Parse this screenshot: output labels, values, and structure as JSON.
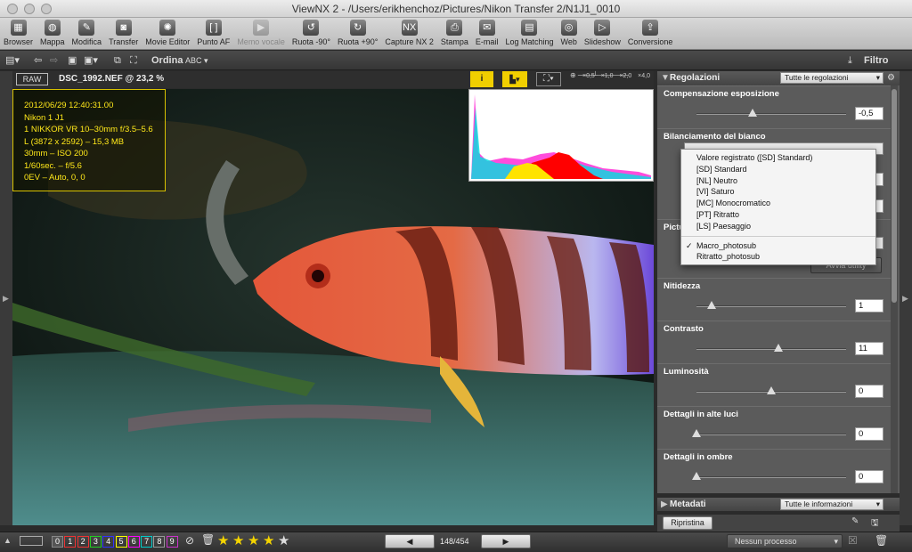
{
  "window": {
    "title": "ViewNX 2 - /Users/erikhenchoz/Pictures/Nikon Transfer 2/N1J1_0010"
  },
  "colors": {
    "accent": "#d8c100",
    "info_text": "#ffe81a"
  },
  "toolbar": {
    "items": [
      {
        "label": "Browser",
        "icon": "browser-icon",
        "enabled": true
      },
      {
        "label": "Mappa",
        "icon": "globe-icon",
        "enabled": true
      },
      {
        "label": "Modifica",
        "icon": "edit-icon",
        "enabled": true
      },
      {
        "label": "Transfer",
        "icon": "camera-icon",
        "enabled": true
      },
      {
        "label": "Movie Editor",
        "icon": "film-reel-icon",
        "enabled": true
      },
      {
        "label": "Punto AF",
        "icon": "af-point-icon",
        "enabled": true
      },
      {
        "label": "Memo vocale",
        "icon": "play-icon",
        "enabled": false
      },
      {
        "label": "Ruota -90°",
        "icon": "rotate-left-icon",
        "enabled": true
      },
      {
        "label": "Ruota +90°",
        "icon": "rotate-right-icon",
        "enabled": true
      },
      {
        "label": "Capture NX 2",
        "icon": "capture-nx-icon",
        "enabled": true
      },
      {
        "label": "Stampa",
        "icon": "print-icon",
        "enabled": true
      },
      {
        "label": "E-mail",
        "icon": "mail-icon",
        "enabled": true
      },
      {
        "label": "Log Matching",
        "icon": "log-icon",
        "enabled": true
      },
      {
        "label": "Web",
        "icon": "web-icon",
        "enabled": true
      },
      {
        "label": "Slideshow",
        "icon": "slideshow-icon",
        "enabled": true
      },
      {
        "label": "Conversione",
        "icon": "convert-icon",
        "enabled": true
      }
    ]
  },
  "subbar": {
    "sort_label": "Ordina",
    "sort_value": "ABC",
    "filter_label": "Filtro"
  },
  "viewer": {
    "raw_badge": "RAW",
    "filename": "DSC_1992.NEF @ 23,2 %",
    "zoom_levels": [
      "×0,5",
      "×1,0",
      "×2,0",
      "×4,0"
    ]
  },
  "info": {
    "lines": [
      "2012/06/29 12:40:31.00",
      "Nikon 1 J1",
      "1 NIKKOR VR 10–30mm f/3.5–5.6",
      "L (3872 x 2592) – 15,3 MB",
      "30mm – ISO 200",
      "1/60sec. – f/5.6",
      "0EV – Auto, 0, 0"
    ]
  },
  "panel": {
    "title": "Regolazioni",
    "filter_select": "Tutte le regolazioni",
    "sections": [
      {
        "label": "Compensazione esposizione",
        "value": "-0,5",
        "level": 0.375
      },
      {
        "label": "Bilanciamento del bianco"
      },
      {
        "label": "Pictu"
      },
      {
        "label": "Nitidezza",
        "value": "1",
        "level": 0.1
      },
      {
        "label": "Contrasto",
        "value": "11",
        "level": 0.55
      },
      {
        "label": "Luminosità",
        "value": "0",
        "level": 0.5
      },
      {
        "label": "Dettagli in alte luci",
        "value": "0",
        "level": 0
      },
      {
        "label": "Dettagli in ombre",
        "value": "0",
        "level": 0
      }
    ],
    "apply_button": "Avvia utility"
  },
  "dropdown": {
    "items": [
      "Valore registrato ([SD] Standard)",
      "[SD] Standard",
      "[NL] Neutro",
      "[VI] Saturo",
      "[MC] Monocromatico",
      "[PT] Ritratto",
      "[LS] Paesaggio"
    ],
    "custom_items": [
      "Macro_photosub",
      "Ritratto_photosub"
    ],
    "checked": "Macro_photosub"
  },
  "metadata": {
    "title": "Metadati",
    "filter_select": "Tutte le informazioni"
  },
  "bottom": {
    "labels": [
      "0",
      "1",
      "2",
      "3",
      "4",
      "5",
      "6",
      "7",
      "8",
      "9"
    ],
    "label_colors": [
      "#888",
      "#e33",
      "#e33",
      "#2c2",
      "#33f",
      "#ff0",
      "#f0f",
      "#0cc",
      "#999",
      "#c3c"
    ],
    "rating": 5,
    "counter": "148/454",
    "reset_button": "Ripristina",
    "process_select": "Nessun processo"
  }
}
